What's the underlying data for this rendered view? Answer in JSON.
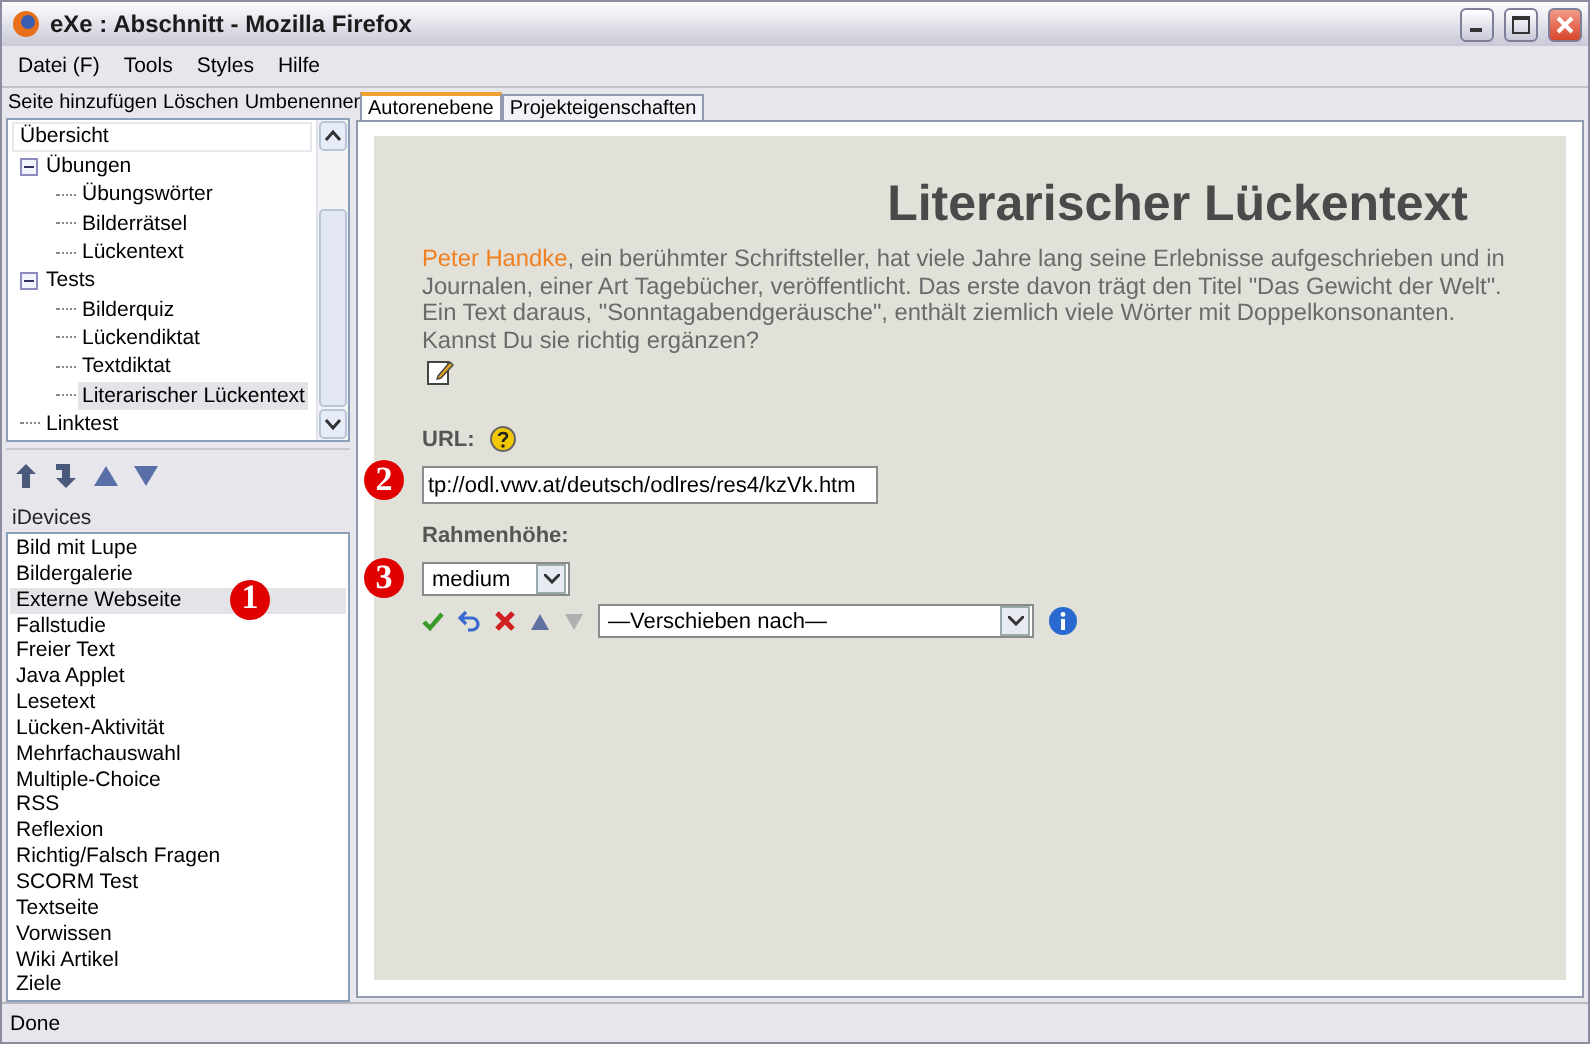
{
  "window": {
    "title": "eXe : Abschnitt - Mozilla Firefox"
  },
  "menu": [
    "Datei (F)",
    "Tools",
    "Styles",
    "Hilfe"
  ],
  "outline_toolbar": [
    "Seite hinzufügen",
    "Löschen",
    "Umbenennen"
  ],
  "tree": {
    "label": "Übersicht",
    "selected": false,
    "children": [
      {
        "label": "Übungen",
        "selected": false,
        "expanded": true,
        "children": [
          {
            "label": "Übungswörter",
            "selected": false
          },
          {
            "label": "Bilderrätsel",
            "selected": false
          },
          {
            "label": "Lückentext",
            "selected": false
          }
        ]
      },
      {
        "label": "Tests",
        "selected": false,
        "expanded": true,
        "children": [
          {
            "label": "Bilderquiz",
            "selected": false
          },
          {
            "label": "Lückendiktat",
            "selected": false
          },
          {
            "label": "Textdiktat",
            "selected": false
          },
          {
            "label": "Literarischer Lückentext",
            "selected": true
          }
        ]
      },
      {
        "label": "Linktest",
        "selected": false
      }
    ]
  },
  "idevices": {
    "title": "iDevices",
    "items": [
      {
        "label": "Bild mit Lupe",
        "selected": false
      },
      {
        "label": "Bildergalerie",
        "selected": false
      },
      {
        "label": "Externe Webseite",
        "selected": true,
        "marker": "1"
      },
      {
        "label": "Fallstudie",
        "selected": false
      },
      {
        "label": "Freier Text",
        "selected": false
      },
      {
        "label": "Java Applet",
        "selected": false
      },
      {
        "label": "Lesetext",
        "selected": false
      },
      {
        "label": "Lücken-Aktivität",
        "selected": false
      },
      {
        "label": "Mehrfachauswahl",
        "selected": false
      },
      {
        "label": "Multiple-Choice",
        "selected": false
      },
      {
        "label": "RSS",
        "selected": false
      },
      {
        "label": "Reflexion",
        "selected": false
      },
      {
        "label": "Richtig/Falsch Fragen",
        "selected": false
      },
      {
        "label": "SCORM Test",
        "selected": false
      },
      {
        "label": "Textseite",
        "selected": false
      },
      {
        "label": "Vorwissen",
        "selected": false
      },
      {
        "label": "Wiki Artikel",
        "selected": false
      },
      {
        "label": "Ziele",
        "selected": false
      }
    ]
  },
  "tabs": [
    {
      "label": "Autorenebene",
      "selected": true
    },
    {
      "label": "Projekteigenschaften",
      "selected": false
    }
  ],
  "content": {
    "title": "Literarischer Lückentext",
    "intro_link": "Peter  Handke",
    "intro_text": ", ein berühmter Schriftsteller, hat viele Jahre lang seine Erlebnisse aufgeschrieben und in Journalen, einer Art Tagebücher, veröffentlicht. Das erste davon trägt den Titel \"Das Gewicht der Welt\". Ein Text daraus, \"Sonntagabendgeräusche\", enthält ziemlich viele Wörter mit Doppelkonsonanten. Kannst Du sie richtig ergänzen?",
    "url_label": "URL:",
    "url_value": "tp://odl.vwv.at/deutsch/odlres/res4/kzVk.htm",
    "url_marker": "2",
    "frame_label": "Rahmenhöhe:",
    "frame_value": "medium",
    "frame_marker": "3",
    "move_select": "—Verschieben nach—"
  },
  "status_bar": "Done"
}
